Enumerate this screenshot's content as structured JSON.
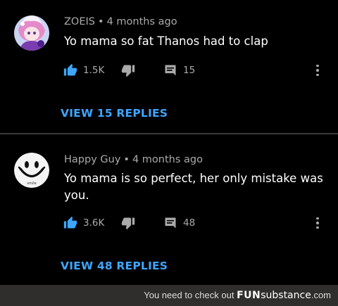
{
  "comments": [
    {
      "author": "ZOEIS",
      "separator": "•",
      "time": "4 months ago",
      "text": "Yo mama so fat Thanos had to clap",
      "likes": "1.5K",
      "reply_count": "15",
      "view_replies": "VIEW 15 REPLIES",
      "avatar_icon": "anime-character-avatar"
    },
    {
      "author": "Happy Guy",
      "separator": "•",
      "time": "4 months ago",
      "text": "Yo mama is so perfect, her only mistake was you.",
      "likes": "3.6K",
      "reply_count": "48",
      "view_replies": "VIEW 48 REPLIES",
      "avatar_icon": "smiley-face-avatar",
      "avatar_caption": "smile"
    }
  ],
  "footer": {
    "text": "You need to check out",
    "brand_bold": "FUN",
    "brand_rest": "substance",
    "brand_tld": ".com"
  },
  "colors": {
    "background": "#000000",
    "link": "#3ea6ff",
    "like_icon": "#3ea6ff",
    "muted": "#aaaaaa",
    "footer_bg": "#302e2c"
  }
}
